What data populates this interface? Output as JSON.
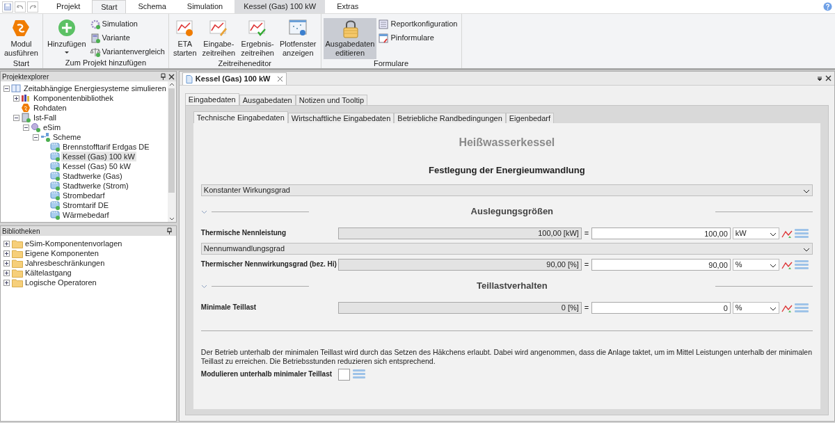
{
  "ribbon_tabs": [
    {
      "label": "Projekt",
      "selected": false,
      "kind": "normal"
    },
    {
      "label": "Start",
      "selected": true,
      "kind": "normal"
    },
    {
      "label": "Schema",
      "selected": false,
      "kind": "normal"
    },
    {
      "label": "Simulation",
      "selected": false,
      "kind": "normal"
    },
    {
      "label": "Kessel (Gas) 100 kW",
      "selected": false,
      "kind": "contextual"
    },
    {
      "label": "Extras",
      "selected": false,
      "kind": "normal"
    }
  ],
  "ribbon_groups": [
    {
      "label": "Start",
      "items": [
        {
          "lines": [
            "Modul",
            "ausführen"
          ],
          "kind": "large",
          "pressed": false
        }
      ]
    },
    {
      "label": "Zum Projekt hinzufügen",
      "items": [
        {
          "lines": [
            "Hinzufügen"
          ],
          "kind": "large",
          "pressed": false,
          "dropdown": true
        },
        {
          "lines": [
            "Simulation"
          ],
          "kind": "small",
          "pressed": false
        },
        {
          "lines": [
            "Variante"
          ],
          "kind": "small",
          "pressed": false
        },
        {
          "lines": [
            "Variantenvergleich"
          ],
          "kind": "small",
          "pressed": false
        }
      ]
    },
    {
      "label": "Zeitreiheneditor",
      "items": [
        {
          "lines": [
            "ETA",
            "starten"
          ],
          "kind": "large",
          "pressed": false
        },
        {
          "lines": [
            "Eingabe-",
            "zeitreihen"
          ],
          "kind": "large",
          "pressed": false
        },
        {
          "lines": [
            "Ergebnis-",
            "zeitreihen"
          ],
          "kind": "large",
          "pressed": false
        },
        {
          "lines": [
            "Plotfenster",
            "anzeigen"
          ],
          "kind": "large",
          "pressed": false
        }
      ]
    },
    {
      "label": "Formulare",
      "items": [
        {
          "lines": [
            "Ausgabedaten",
            "editieren"
          ],
          "kind": "large",
          "pressed": true
        },
        {
          "lines": [
            "Reportkonfiguration"
          ],
          "kind": "small",
          "pressed": false
        },
        {
          "lines": [
            "Pinformulare"
          ],
          "kind": "small",
          "pressed": false
        }
      ]
    }
  ],
  "project_explorer": {
    "title": "Projektexplorer",
    "tree": [
      {
        "label": "Zeitabhängige Energiesysteme simulieren",
        "kind": "project",
        "expanded": true,
        "selected": false,
        "children": [
          {
            "label": "Komponentenbibliothek",
            "kind": "library",
            "expanded": false,
            "selected": false
          },
          {
            "label": "Rohdaten",
            "kind": "data",
            "selected": false
          },
          {
            "label": "Ist-Fall",
            "kind": "variant",
            "expanded": true,
            "selected": false,
            "children": [
              {
                "label": "eSim",
                "kind": "sim",
                "expanded": true,
                "selected": false,
                "children": [
                  {
                    "label": "Scheme",
                    "kind": "scheme",
                    "expanded": true,
                    "selected": false,
                    "children": [
                      {
                        "label": "Brennstofftarif Erdgas DE",
                        "kind": "component",
                        "selected": false
                      },
                      {
                        "label": "Kessel (Gas) 100 kW",
                        "kind": "component",
                        "selected": true
                      },
                      {
                        "label": "Kessel (Gas) 50 kW",
                        "kind": "component",
                        "selected": false
                      },
                      {
                        "label": "Stadtwerke (Gas)",
                        "kind": "component",
                        "selected": false
                      },
                      {
                        "label": "Stadtwerke (Strom)",
                        "kind": "component",
                        "selected": false
                      },
                      {
                        "label": "Strombedarf",
                        "kind": "component",
                        "selected": false
                      },
                      {
                        "label": "Stromtarif DE",
                        "kind": "component",
                        "selected": false
                      },
                      {
                        "label": "Wärmebedarf",
                        "kind": "component",
                        "selected": false
                      }
                    ]
                  }
                ]
              }
            ]
          }
        ]
      }
    ]
  },
  "libraries": {
    "title": "Bibliotheken",
    "items": [
      {
        "label": "eSim-Komponentenvorlagen",
        "expanded": false
      },
      {
        "label": "Eigene Komponenten",
        "expanded": false
      },
      {
        "label": "Jahresbeschränkungen",
        "expanded": false
      },
      {
        "label": "Kältelastgang",
        "expanded": false
      },
      {
        "label": "Logische Operatoren",
        "expanded": false
      }
    ]
  },
  "document": {
    "tab": "Kessel (Gas) 100 kW",
    "main_tabs": [
      {
        "label": "Eingabedaten",
        "selected": true
      },
      {
        "label": "Ausgabedaten",
        "selected": false
      },
      {
        "label": "Notizen und Tooltip",
        "selected": false
      }
    ],
    "sub_tabs": [
      {
        "label": "Technische Eingabedaten",
        "selected": true
      },
      {
        "label": "Wirtschaftliche Eingabedaten",
        "selected": false
      },
      {
        "label": "Betriebliche Randbedingungen",
        "selected": false
      },
      {
        "label": "Eigenbedarf",
        "selected": false
      }
    ],
    "form": {
      "title": "Heißwasserkessel",
      "section": "Festlegung der Energieumwandlung",
      "mode_select": "Konstanter Wirkungsgrad",
      "groups": [
        {
          "title": "Auslegungsgrößen",
          "expanded": true,
          "rows": [
            {
              "kind": "param",
              "label": "Thermische Nennleistung",
              "computed": "100,00 [kW]",
              "equals": "=",
              "value": "100,00",
              "unit": "kW"
            },
            {
              "kind": "select",
              "value": "Nennumwandlungsgrad"
            },
            {
              "kind": "param",
              "label": "Thermischer Nennwirkungsgrad (bez. Hi)",
              "computed": "90,00 [%]",
              "equals": "=",
              "value": "90,00",
              "unit": "%"
            }
          ]
        },
        {
          "title": "Teillastverhalten",
          "expanded": true,
          "rows": [
            {
              "kind": "param",
              "label": "Minimale Teillast",
              "computed": "0 [%]",
              "equals": "=",
              "value": "0",
              "unit": "%"
            }
          ]
        }
      ],
      "note": "Der Betrieb unterhalb der minimalen Teillast wird durch das Setzen des Häkchens erlaubt. Dabei wird angenommen, dass die Anlage taktet, um im Mittel Leistungen unterhalb der minimalen Teillast zu erreichen. Die Betriebsstunden reduzieren sich entsprechend.",
      "checkbox": {
        "label": "Modulieren unterhalb minimaler Teillast",
        "checked": false
      }
    }
  }
}
